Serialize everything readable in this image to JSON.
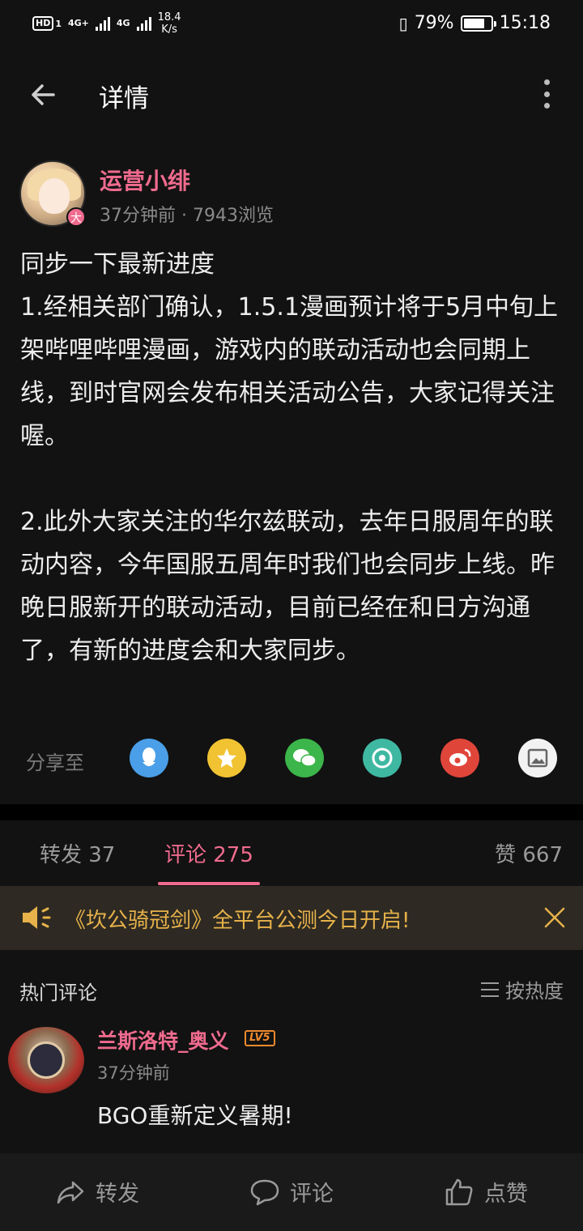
{
  "status_bar": {
    "hd": "HD",
    "sim1": "1",
    "net1": "4G+",
    "net2": "4G",
    "speed_value": "18.4",
    "speed_unit": "K/s",
    "battery_text": "79%",
    "battery_level": 0.79,
    "time": "15:18"
  },
  "header": {
    "title": "详情"
  },
  "post": {
    "author_name": "运营小绯",
    "avatar_badge": "大",
    "meta": "37分钟前 · 7943浏览",
    "body": "同步一下最新进度\n1.经相关部门确认，1.5.1漫画预计将于5月中旬上架哔哩哔哩漫画，游戏内的联动活动也会同期上线，到时官网会发布相关活动公告，大家记得关注喔。\n\n2.此外大家关注的华尔兹联动，去年日服周年的联动内容，今年国服五周年时我们也会同步上线。昨晚日服新开的联动活动，目前已经在和日方沟通了，有新的进度会和大家同步。"
  },
  "share": {
    "label": "分享至",
    "targets": [
      {
        "icon": "qq-icon",
        "color": "#4a9fe8"
      },
      {
        "icon": "qzone-star-icon",
        "color": "#f1c232"
      },
      {
        "icon": "wechat-icon",
        "color": "#3cb54a"
      },
      {
        "icon": "moments-icon",
        "color": "#3fb8a2"
      },
      {
        "icon": "weibo-icon",
        "color": "#e0453a"
      },
      {
        "icon": "gallery-icon",
        "color": "#f2f2f2"
      }
    ]
  },
  "tabs": {
    "repost": "转发 37",
    "comments": "评论 275",
    "likes": "赞 667",
    "active": "comments"
  },
  "notice": {
    "text": "《坎公骑冠剑》全平台公测今日开启!",
    "color": "#e7b24a"
  },
  "comments": {
    "section_title": "热门评论",
    "sort_label": "按热度",
    "items": [
      {
        "name": "兰斯洛特_奥义",
        "level": "LV5",
        "time": "37分钟前",
        "text": "BGO重新定义暑期!"
      }
    ]
  },
  "bottom_bar": {
    "repost": "转发",
    "comment": "评论",
    "like": "点赞"
  },
  "colors": {
    "accent": "#f06b8e",
    "background": "#121212"
  }
}
